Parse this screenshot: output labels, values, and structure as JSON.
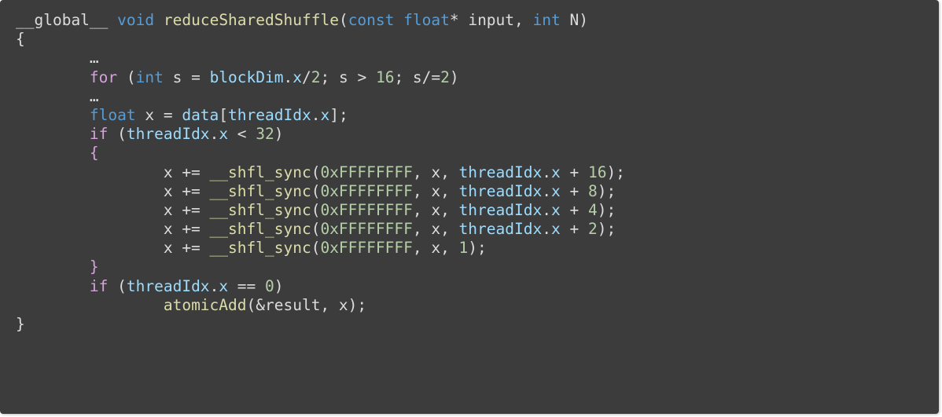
{
  "code_block": {
    "language": "cuda",
    "lines": [
      [
        {
          "t": "__global__",
          "k": "plain"
        },
        {
          "t": " ",
          "k": "plain"
        },
        {
          "t": "void",
          "k": "type"
        },
        {
          "t": " ",
          "k": "plain"
        },
        {
          "t": "reduceSharedShuffle",
          "k": "func"
        },
        {
          "t": "(",
          "k": "plain"
        },
        {
          "t": "const",
          "k": "type"
        },
        {
          "t": " ",
          "k": "plain"
        },
        {
          "t": "float",
          "k": "type"
        },
        {
          "t": "* input, ",
          "k": "plain"
        },
        {
          "t": "int",
          "k": "type"
        },
        {
          "t": " N)",
          "k": "plain"
        }
      ],
      [
        {
          "t": "{",
          "k": "plain"
        }
      ],
      [
        {
          "t": "        ",
          "k": "plain"
        },
        {
          "t": "…",
          "k": "plain"
        }
      ],
      [
        {
          "t": "        ",
          "k": "plain"
        },
        {
          "t": "for",
          "k": "control"
        },
        {
          "t": " (",
          "k": "plain"
        },
        {
          "t": "int",
          "k": "type"
        },
        {
          "t": " s = ",
          "k": "plain"
        },
        {
          "t": "blockDim",
          "k": "var"
        },
        {
          "t": ".",
          "k": "plain"
        },
        {
          "t": "x",
          "k": "member"
        },
        {
          "t": "/",
          "k": "plain"
        },
        {
          "t": "2",
          "k": "number"
        },
        {
          "t": "; s > ",
          "k": "plain"
        },
        {
          "t": "16",
          "k": "number"
        },
        {
          "t": "; s/=",
          "k": "plain"
        },
        {
          "t": "2",
          "k": "number"
        },
        {
          "t": ")",
          "k": "plain"
        }
      ],
      [
        {
          "t": "        ",
          "k": "plain"
        },
        {
          "t": "…",
          "k": "plain"
        }
      ],
      [
        {
          "t": "        ",
          "k": "plain"
        },
        {
          "t": "float",
          "k": "type"
        },
        {
          "t": " x = ",
          "k": "plain"
        },
        {
          "t": "data",
          "k": "var"
        },
        {
          "t": "[",
          "k": "plain"
        },
        {
          "t": "threadIdx",
          "k": "var"
        },
        {
          "t": ".",
          "k": "plain"
        },
        {
          "t": "x",
          "k": "member"
        },
        {
          "t": "];",
          "k": "plain"
        }
      ],
      [
        {
          "t": "        ",
          "k": "plain"
        },
        {
          "t": "if",
          "k": "control"
        },
        {
          "t": " (",
          "k": "plain"
        },
        {
          "t": "threadIdx",
          "k": "var"
        },
        {
          "t": ".",
          "k": "plain"
        },
        {
          "t": "x",
          "k": "member"
        },
        {
          "t": " < ",
          "k": "plain"
        },
        {
          "t": "32",
          "k": "number"
        },
        {
          "t": ")",
          "k": "plain"
        }
      ],
      [
        {
          "t": "        ",
          "k": "plain"
        },
        {
          "t": "{",
          "k": "control"
        }
      ],
      [
        {
          "t": "                x += ",
          "k": "plain"
        },
        {
          "t": "__shfl_sync",
          "k": "func"
        },
        {
          "t": "(",
          "k": "plain"
        },
        {
          "t": "0xFFFFFFFF",
          "k": "number"
        },
        {
          "t": ", x, ",
          "k": "plain"
        },
        {
          "t": "threadIdx",
          "k": "var"
        },
        {
          "t": ".",
          "k": "plain"
        },
        {
          "t": "x",
          "k": "member"
        },
        {
          "t": " + ",
          "k": "plain"
        },
        {
          "t": "16",
          "k": "number"
        },
        {
          "t": ");",
          "k": "plain"
        }
      ],
      [
        {
          "t": "                x += ",
          "k": "plain"
        },
        {
          "t": "__shfl_sync",
          "k": "func"
        },
        {
          "t": "(",
          "k": "plain"
        },
        {
          "t": "0xFFFFFFFF",
          "k": "number"
        },
        {
          "t": ", x, ",
          "k": "plain"
        },
        {
          "t": "threadIdx",
          "k": "var"
        },
        {
          "t": ".",
          "k": "plain"
        },
        {
          "t": "x",
          "k": "member"
        },
        {
          "t": " + ",
          "k": "plain"
        },
        {
          "t": "8",
          "k": "number"
        },
        {
          "t": ");",
          "k": "plain"
        }
      ],
      [
        {
          "t": "                x += ",
          "k": "plain"
        },
        {
          "t": "__shfl_sync",
          "k": "func"
        },
        {
          "t": "(",
          "k": "plain"
        },
        {
          "t": "0xFFFFFFFF",
          "k": "number"
        },
        {
          "t": ", x, ",
          "k": "plain"
        },
        {
          "t": "threadIdx",
          "k": "var"
        },
        {
          "t": ".",
          "k": "plain"
        },
        {
          "t": "x",
          "k": "member"
        },
        {
          "t": " + ",
          "k": "plain"
        },
        {
          "t": "4",
          "k": "number"
        },
        {
          "t": ");",
          "k": "plain"
        }
      ],
      [
        {
          "t": "                x += ",
          "k": "plain"
        },
        {
          "t": "__shfl_sync",
          "k": "func"
        },
        {
          "t": "(",
          "k": "plain"
        },
        {
          "t": "0xFFFFFFFF",
          "k": "number"
        },
        {
          "t": ", x, ",
          "k": "plain"
        },
        {
          "t": "threadIdx",
          "k": "var"
        },
        {
          "t": ".",
          "k": "plain"
        },
        {
          "t": "x",
          "k": "member"
        },
        {
          "t": " + ",
          "k": "plain"
        },
        {
          "t": "2",
          "k": "number"
        },
        {
          "t": ");",
          "k": "plain"
        }
      ],
      [
        {
          "t": "                x += ",
          "k": "plain"
        },
        {
          "t": "__shfl_sync",
          "k": "func"
        },
        {
          "t": "(",
          "k": "plain"
        },
        {
          "t": "0xFFFFFFFF",
          "k": "number"
        },
        {
          "t": ", x, ",
          "k": "plain"
        },
        {
          "t": "1",
          "k": "number"
        },
        {
          "t": ");",
          "k": "plain"
        }
      ],
      [
        {
          "t": "        ",
          "k": "plain"
        },
        {
          "t": "}",
          "k": "control"
        }
      ],
      [
        {
          "t": "        ",
          "k": "plain"
        },
        {
          "t": "if",
          "k": "control"
        },
        {
          "t": " (",
          "k": "plain"
        },
        {
          "t": "threadIdx",
          "k": "var"
        },
        {
          "t": ".",
          "k": "plain"
        },
        {
          "t": "x",
          "k": "member"
        },
        {
          "t": " == ",
          "k": "plain"
        },
        {
          "t": "0",
          "k": "number"
        },
        {
          "t": ")",
          "k": "plain"
        }
      ],
      [
        {
          "t": "                ",
          "k": "plain"
        },
        {
          "t": "atomicAdd",
          "k": "func"
        },
        {
          "t": "(&result, x);",
          "k": "plain"
        }
      ],
      [
        {
          "t": "}",
          "k": "plain"
        }
      ]
    ]
  },
  "colors": {
    "background": "#3c3c3c",
    "plain": "#dcdcdc",
    "type": "#569cd6",
    "control": "#d8a0df",
    "func": "#dcdcaa",
    "var": "#9cdcfe",
    "member": "#9cdcfe",
    "number": "#b5cea8"
  }
}
